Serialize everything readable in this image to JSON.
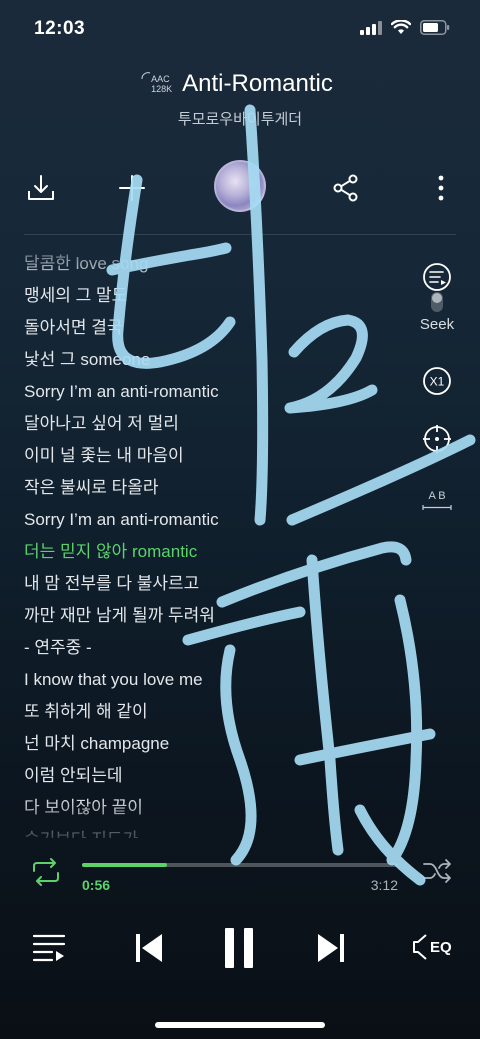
{
  "status_bar": {
    "time": "12:03"
  },
  "header": {
    "codec_line1": "AAC",
    "codec_line2": "128K",
    "title": "Anti-Romantic",
    "artist": "투모로우바이투게더"
  },
  "lyrics": [
    {
      "text": "달콤한 love song",
      "current": false
    },
    {
      "text": "맹세의 그 말도",
      "current": false
    },
    {
      "text": "돌아서면 결국",
      "current": false
    },
    {
      "text": "낯선 그 someone",
      "current": false
    },
    {
      "text": "Sorry I’m an anti-romantic",
      "current": false
    },
    {
      "text": "달아나고 싶어 저 멀리",
      "current": false
    },
    {
      "text": "이미 널 좇는 내 마음이",
      "current": false
    },
    {
      "text": "작은 불씨로 타올라",
      "current": false
    },
    {
      "text": "Sorry I’m an anti-romantic",
      "current": false
    },
    {
      "text": "더는 믿지 않아 romantic",
      "current": true
    },
    {
      "text": "내 맘 전부를 다 불사르고",
      "current": false
    },
    {
      "text": "까만 재만 남게 될까 두려워",
      "current": false
    },
    {
      "text": " - 연주중 -",
      "current": false
    },
    {
      "text": "I know that you love me",
      "current": false
    },
    {
      "text": "또 취하게 해 같이",
      "current": false
    },
    {
      "text": "넌 마치 champagne",
      "current": false
    },
    {
      "text": "이럼 안되는데",
      "current": false
    },
    {
      "text": "다 보이잖아 끝이",
      "current": false
    },
    {
      "text": "숨기보다 지도가",
      "current": false
    }
  ],
  "side": {
    "seek_label": "Seek",
    "speed_label": "X1",
    "ab_label": "A B"
  },
  "playback": {
    "elapsed": "0:56",
    "total": "3:12",
    "progress": 0.27
  },
  "controls": {
    "eq_label": "EQ"
  },
  "colors": {
    "accent": "#5bd36a",
    "scribble": "#a6dcf4"
  }
}
